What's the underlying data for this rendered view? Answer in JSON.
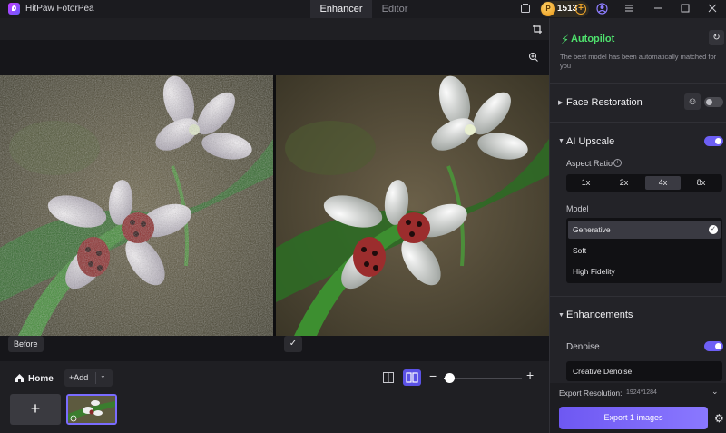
{
  "app": {
    "title": "HitPaw FotorPea"
  },
  "tabs": [
    {
      "label": "Enhancer",
      "active": true
    },
    {
      "label": "Editor",
      "active": false
    }
  ],
  "titlebar": {
    "credits": "1513"
  },
  "canvas": {
    "before_label": "Before"
  },
  "bottom": {
    "home_label": "Home",
    "add_label": "Add",
    "zoom_level": 0.07
  },
  "panel": {
    "autopilot_title": "Autopilot",
    "autopilot_desc": "The best model has been automatically matched for you",
    "face_restoration": {
      "title": "Face Restoration",
      "enabled": false
    },
    "ai_upscale": {
      "title": "AI Upscale",
      "enabled": true,
      "aspect_ratio_label": "Aspect Ratio",
      "ratios": [
        "1x",
        "2x",
        "4x",
        "8x"
      ],
      "selected_ratio": "4x",
      "model_label": "Model",
      "models": [
        "Generative",
        "Soft",
        "High Fidelity"
      ],
      "selected_model": "Generative"
    },
    "enhancements": {
      "title": "Enhancements",
      "denoise_label": "Denoise",
      "denoise_enabled": true,
      "denoise_option": "Creative Denoise"
    },
    "export": {
      "resolution_label": "Export Resolution:",
      "resolution_value": "1924*1284",
      "button_label": "Export 1 images"
    }
  },
  "colors": {
    "accent": "#6d5ff5",
    "autopilot_green": "#4ee06d",
    "credits_gold": "#f3a72a"
  },
  "icons": [
    "crop-icon",
    "zoom-in-icon",
    "check-icon",
    "home-icon",
    "plus-icon",
    "chevron-down-icon",
    "single-view-icon",
    "split-view-icon",
    "refresh-icon",
    "smiley-icon",
    "info-icon",
    "gear-icon",
    "lightning-icon"
  ]
}
